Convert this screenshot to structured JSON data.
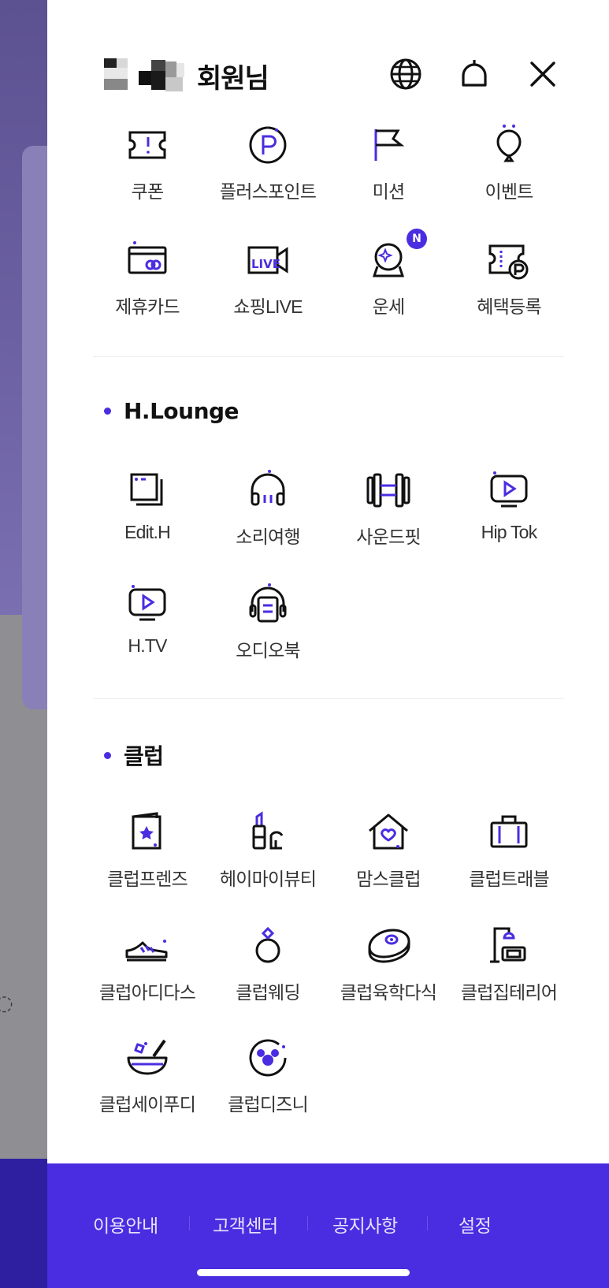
{
  "header": {
    "user_name": "회원님",
    "globe_icon": "globe-icon",
    "bell_icon": "bell-icon",
    "close_icon": "close-icon"
  },
  "quick_menu": [
    {
      "label": "쿠폰",
      "icon": "coupon-icon"
    },
    {
      "label": "플러스포인트",
      "icon": "plus-point-icon"
    },
    {
      "label": "미션",
      "icon": "flag-icon"
    },
    {
      "label": "이벤트",
      "icon": "balloon-icon"
    },
    {
      "label": "제휴카드",
      "icon": "card-icon"
    },
    {
      "label": "쇼핑LIVE",
      "icon": "live-icon"
    },
    {
      "label": "운세",
      "icon": "crystal-ball-icon",
      "badge": "N"
    },
    {
      "label": "혜택등록",
      "icon": "benefit-ticket-icon"
    }
  ],
  "lounge": {
    "title": "H.Lounge",
    "items": [
      {
        "label": "Edit.H",
        "icon": "edit-h-icon"
      },
      {
        "label": "소리여행",
        "icon": "headphones-icon"
      },
      {
        "label": "사운드핏",
        "icon": "dumbbell-icon"
      },
      {
        "label": "Hip Tok",
        "icon": "video-play-icon"
      },
      {
        "label": "H.TV",
        "icon": "tv-play-icon"
      },
      {
        "label": "오디오북",
        "icon": "audiobook-icon"
      }
    ]
  },
  "club": {
    "title": "클럽",
    "items": [
      {
        "label": "클럽프렌즈",
        "icon": "star-card-icon"
      },
      {
        "label": "헤이마이뷰티",
        "icon": "lipstick-icon"
      },
      {
        "label": "맘스클럽",
        "icon": "heart-house-icon"
      },
      {
        "label": "클럽트래블",
        "icon": "suitcase-icon"
      },
      {
        "label": "클럽아디다스",
        "icon": "sneaker-icon"
      },
      {
        "label": "클럽웨딩",
        "icon": "ring-icon"
      },
      {
        "label": "클럽육학다식",
        "icon": "steak-icon"
      },
      {
        "label": "클럽집테리어",
        "icon": "lamp-chair-icon"
      },
      {
        "label": "클럽세이푸디",
        "icon": "mortar-bowl-icon"
      },
      {
        "label": "클럽디즈니",
        "icon": "mouse-circle-icon"
      }
    ]
  },
  "footer": {
    "links": [
      "이용안내",
      "고객센터",
      "공지사항",
      "설정"
    ]
  },
  "colors": {
    "accent": "#4a2de0",
    "footer_bg": "#4a2de0",
    "text": "#333333"
  }
}
